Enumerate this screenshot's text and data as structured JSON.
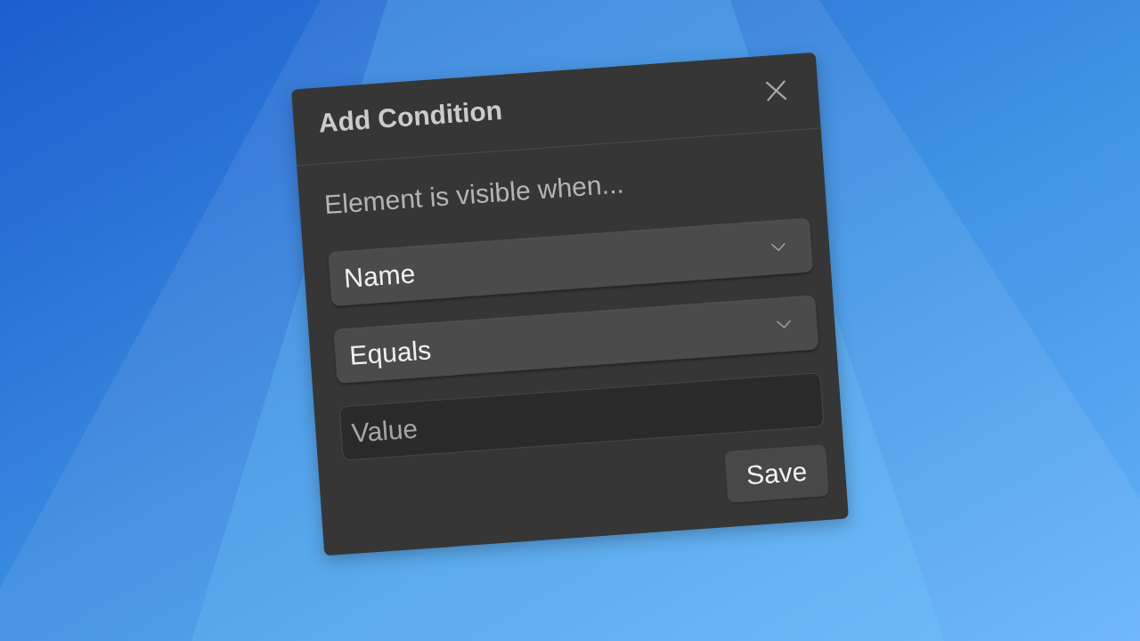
{
  "dialog": {
    "title": "Add Condition",
    "prompt": "Element is visible when...",
    "fields": [
      {
        "kind": "select",
        "value": "Name"
      },
      {
        "kind": "select",
        "value": "Equals"
      },
      {
        "kind": "input",
        "placeholder": "Value"
      }
    ],
    "actions": [
      "Save"
    ]
  }
}
